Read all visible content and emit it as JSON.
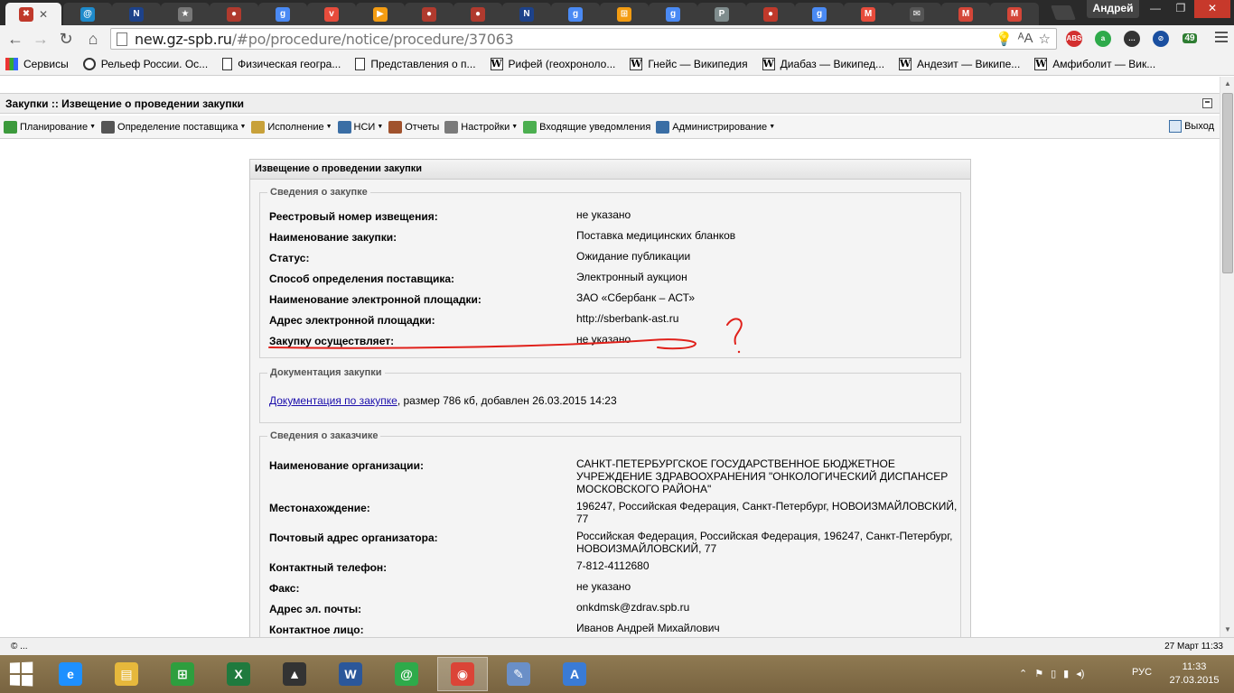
{
  "browser": {
    "tabs": [
      {
        "icon": "tools-icon",
        "color": "#c0392b",
        "glyph": "✖"
      },
      {
        "icon": "mail-at-icon",
        "color": "#1e8acb",
        "glyph": "@"
      },
      {
        "icon": "nba-icon",
        "color": "#1d428a",
        "glyph": "N"
      },
      {
        "icon": "star-icon",
        "color": "#777777",
        "glyph": "★"
      },
      {
        "icon": "ball-icon",
        "color": "#b03a2e",
        "glyph": "●"
      },
      {
        "icon": "google-icon",
        "color": "#4a8af4",
        "glyph": "g"
      },
      {
        "icon": "pocket-icon",
        "color": "#e74c3c",
        "glyph": "v"
      },
      {
        "icon": "play-icon",
        "color": "#f39c12",
        "glyph": "▶"
      },
      {
        "icon": "ball-icon",
        "color": "#b03a2e",
        "glyph": "●"
      },
      {
        "icon": "ball-icon",
        "color": "#b03a2e",
        "glyph": "●"
      },
      {
        "icon": "nba-icon",
        "color": "#1d428a",
        "glyph": "N"
      },
      {
        "icon": "google-icon",
        "color": "#4a8af4",
        "glyph": "g"
      },
      {
        "icon": "cart-icon",
        "color": "#f39c12",
        "glyph": "⊞"
      },
      {
        "icon": "google-icon",
        "color": "#4a8af4",
        "glyph": "g"
      },
      {
        "icon": "p-icon",
        "color": "#7f8c8d",
        "glyph": "P"
      },
      {
        "icon": "round-icon",
        "color": "#c0392b",
        "glyph": "●"
      },
      {
        "icon": "google-icon",
        "color": "#4a8af4",
        "glyph": "g"
      },
      {
        "icon": "m-icon",
        "color": "#e74c3c",
        "glyph": "M"
      },
      {
        "icon": "envelope-icon",
        "color": "#555555",
        "glyph": "✉"
      },
      {
        "icon": "gmail-icon",
        "color": "#d44638",
        "glyph": "M"
      },
      {
        "icon": "gmail-icon",
        "color": "#d44638",
        "glyph": "M"
      }
    ],
    "profile": "Андрей",
    "url_host": "new.gz-spb.ru",
    "url_path": "/#po/procedure/notice/procedure/37063",
    "ext_badge": "49",
    "bookmarks": [
      {
        "icon": "apps-grid-icon",
        "kind": "grid",
        "label": "Сервисы"
      },
      {
        "icon": "globe-icon",
        "kind": "globe",
        "label": "Рельеф России. Ос..."
      },
      {
        "icon": "page-icon",
        "kind": "doc",
        "label": "Физическая геогра..."
      },
      {
        "icon": "page-icon",
        "kind": "doc",
        "label": "Представления о п..."
      },
      {
        "icon": "wikipedia-icon",
        "kind": "wiki",
        "label": "Рифей (геохроноло..."
      },
      {
        "icon": "wikipedia-icon",
        "kind": "wiki",
        "label": "Гнейс — Википедия"
      },
      {
        "icon": "wikipedia-icon",
        "kind": "wiki",
        "label": "Диабаз — Википед..."
      },
      {
        "icon": "wikipedia-icon",
        "kind": "wiki",
        "label": "Андезит — Википе..."
      },
      {
        "icon": "wikipedia-icon",
        "kind": "wiki",
        "label": "Амфиболит — Вик..."
      }
    ]
  },
  "app": {
    "header_title": "Закупки :: Извещение о проведении закупки",
    "menu": [
      {
        "label": "Планирование",
        "dropdown": true,
        "icon_color": "#3c9a3c"
      },
      {
        "label": "Определение поставщика",
        "dropdown": true,
        "icon_color": "#555555"
      },
      {
        "label": "Исполнение",
        "dropdown": true,
        "icon_color": "#c8a13a"
      },
      {
        "label": "НСИ",
        "dropdown": true,
        "icon_color": "#3a6ea5"
      },
      {
        "label": "Отчеты",
        "dropdown": false,
        "icon_color": "#a0522d"
      },
      {
        "label": "Настройки",
        "dropdown": true,
        "icon_color": "#7a7a7a"
      },
      {
        "label": "Входящие уведомления",
        "dropdown": false,
        "icon_color": "#4caf50"
      },
      {
        "label": "Администрирование",
        "dropdown": true,
        "icon_color": "#3a6ea5"
      }
    ],
    "logout": "Выход"
  },
  "notice": {
    "panel_title": "Извещение о проведении закупки",
    "procurement": {
      "legend": "Сведения о закупке",
      "rows": [
        {
          "label": "Реестровый номер извещения:",
          "value": "не указано"
        },
        {
          "label": "Наименование закупки:",
          "value": "Поставка медицинских бланков"
        },
        {
          "label": "Статус:",
          "value": "Ожидание публикации"
        },
        {
          "label": "Способ определения поставщика:",
          "value": "Электронный аукцион"
        },
        {
          "label": "Наименование электронной площадки:",
          "value": "ЗАО «Сбербанк – АСТ»"
        },
        {
          "label": "Адрес электронной площадки:",
          "value": "http://sberbank-ast.ru"
        },
        {
          "label": "Закупку осуществляет:",
          "value": "не указано"
        }
      ]
    },
    "documentation": {
      "legend": "Документация закупки",
      "link_text": "Документация по закупке",
      "details": ", размер 786 кб, добавлен 26.03.2015 14:23"
    },
    "customer": {
      "legend": "Сведения о заказчике",
      "rows": [
        {
          "label": "Наименование организации:",
          "value": "САНКТ-ПЕТЕРБУРГСКОЕ ГОСУДАРСТВЕННОЕ БЮДЖЕТНОЕ УЧРЕЖДЕНИЕ ЗДРАВООХРАНЕНИЯ \"ОНКОЛОГИЧЕСКИЙ ДИСПАНСЕР МОСКОВСКОГО РАЙОНА\""
        },
        {
          "label": "Местонахождение:",
          "value": "196247, Российская Федерация, Санкт-Петербург, НОВОИЗМАЙЛОВСКИЙ, 77"
        },
        {
          "label": "Почтовый адрес организатора:",
          "value": "Российская Федерация, Российская Федерация, 196247, Санкт-Петербург, НОВОИЗМАЙЛОВСКИЙ, 77"
        },
        {
          "label": "Контактный телефон:",
          "value": "7-812-4112680"
        },
        {
          "label": "Факс:",
          "value": "не указано"
        },
        {
          "label": "Адрес эл. почты:",
          "value": "onkdmsk@zdrav.spb.ru"
        },
        {
          "label": "Контактное лицо:",
          "value": "Иванов Андрей Михайлович"
        }
      ]
    },
    "annotation_color": "#e0201a"
  },
  "statusbar": {
    "left": "© ...",
    "right": "27 Март 11:33"
  },
  "taskbar": {
    "apps": [
      {
        "icon": "internet-explorer-icon",
        "color": "#1e90ff",
        "glyph": "e"
      },
      {
        "icon": "file-explorer-icon",
        "color": "#e6b83c",
        "glyph": "▤"
      },
      {
        "icon": "store-icon",
        "color": "#2e9e3e",
        "glyph": "⊞"
      },
      {
        "icon": "excel-icon",
        "color": "#1f7a3e",
        "glyph": "X"
      },
      {
        "icon": "graduation-app-icon",
        "color": "#333333",
        "glyph": "▲"
      },
      {
        "icon": "word-icon",
        "color": "#2b579a",
        "glyph": "W"
      },
      {
        "icon": "mail-agent-icon",
        "color": "#2eaa4a",
        "glyph": "@"
      },
      {
        "icon": "chrome-icon",
        "color": "#db4437",
        "glyph": "◉"
      },
      {
        "icon": "paint-icon",
        "color": "#6a8fc7",
        "glyph": "✎"
      },
      {
        "icon": "app-triangle-icon",
        "color": "#3a7bd5",
        "glyph": "A"
      }
    ],
    "language": "РУС",
    "time": "11:33",
    "date": "27.03.2015"
  }
}
